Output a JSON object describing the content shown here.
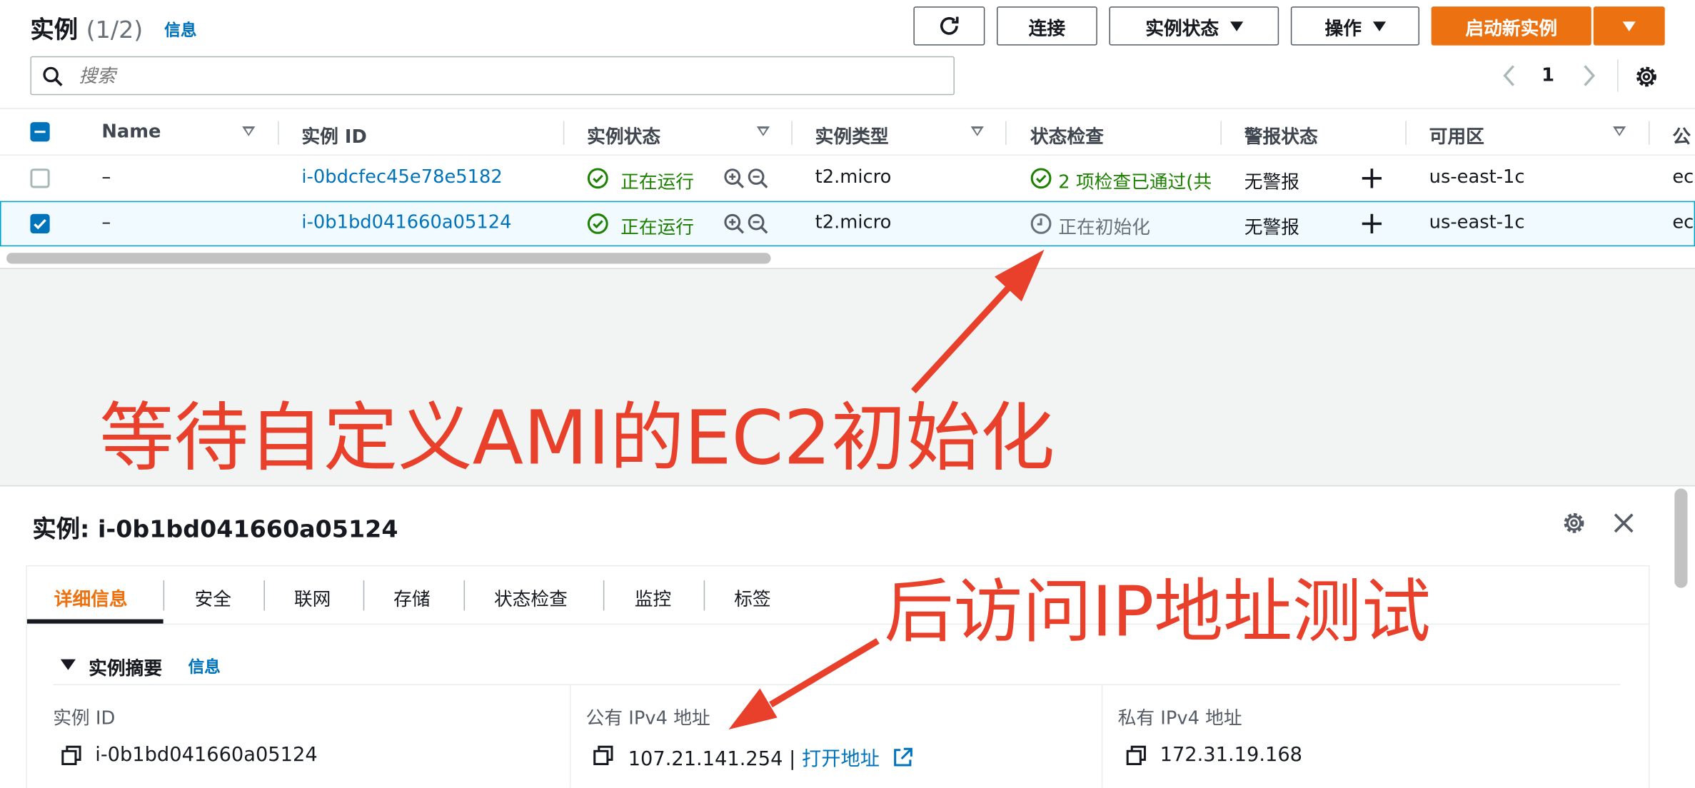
{
  "header": {
    "title": "实例",
    "count": "(1/2)",
    "info": "信息"
  },
  "toolbar": {
    "connect": "连接",
    "instance_state": "实例状态",
    "actions": "操作",
    "launch": "启动新实例"
  },
  "search": {
    "placeholder": "搜索"
  },
  "pagination": {
    "page": "1"
  },
  "table": {
    "columns": [
      "Name",
      "实例 ID",
      "实例状态",
      "实例类型",
      "状态检查",
      "警报状态",
      "可用区",
      "公"
    ],
    "rows": [
      {
        "name": "–",
        "id": "i-0bdcfec45e78e5182",
        "state": "正在运行",
        "type": "t2.micro",
        "check": "2 项检查已通过(共",
        "alarm": "无警报",
        "az": "us-east-1c",
        "dns": "ec",
        "selected": false
      },
      {
        "name": "–",
        "id": "i-0b1bd041660a05124",
        "state": "正在运行",
        "type": "t2.micro",
        "check": "正在初始化",
        "alarm": "无警报",
        "az": "us-east-1c",
        "dns": "ec",
        "selected": true
      }
    ]
  },
  "annotations": {
    "top": "等待自定义AMI的EC2初始化",
    "bottom": "后访问IP地址测试"
  },
  "detail": {
    "title": "实例: i-0b1bd041660a05124",
    "tabs": [
      "详细信息",
      "安全",
      "联网",
      "存储",
      "状态检查",
      "监控",
      "标签"
    ],
    "summary_title": "实例摘要",
    "summary_info": "信息",
    "fields": [
      {
        "label": "实例 ID",
        "value": "i-0b1bd041660a05124"
      },
      {
        "label": "公有 IPv4 地址",
        "value": "107.21.141.254",
        "sep": " | ",
        "link": "打开地址"
      },
      {
        "label": "私有 IPv4 地址",
        "value": "172.31.19.168"
      }
    ]
  },
  "colors": {
    "primary": "#ec7211",
    "link": "#0073bb",
    "success": "#1d8102",
    "annotation": "#e8402b",
    "selected_bg": "#f1faff"
  }
}
